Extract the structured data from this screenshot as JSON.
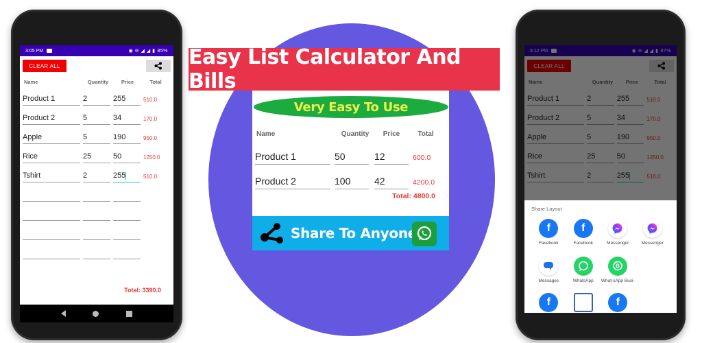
{
  "promo": {
    "title": "Easy List Calculator And Bills",
    "tagline": "Very Easy To Use",
    "share_text": "Share To Anyone",
    "colors": {
      "circle": "#6457e0",
      "banner": "#e8334a",
      "pill": "#1cab3e",
      "share_bar": "#10aee8"
    },
    "headers": {
      "name": "Name",
      "quantity": "Quantity",
      "price": "Price",
      "total": "Total"
    },
    "rows": [
      {
        "name": "Product 1",
        "quantity": "50",
        "price": "12",
        "total": "600.0"
      },
      {
        "name": "Product 2",
        "quantity": "100",
        "price": "42",
        "total": "4200.0"
      }
    ],
    "grand_total": "Total: 4800.0"
  },
  "left_phone": {
    "status": {
      "time": "3:05 PM",
      "battery": "85%"
    },
    "clear_label": "CLEAR ALL",
    "headers": {
      "name": "Name",
      "quantity": "Quantity",
      "price": "Price",
      "total": "Total"
    },
    "rows": [
      {
        "name": "Product 1",
        "quantity": "2",
        "price": "255",
        "total": "510.0"
      },
      {
        "name": "Product 2",
        "quantity": "5",
        "price": "34",
        "total": "170.0"
      },
      {
        "name": "Apple",
        "quantity": "5",
        "price": "190",
        "total": "950.0"
      },
      {
        "name": "Rice",
        "quantity": "25",
        "price": "50",
        "total": "1250.0"
      },
      {
        "name": "Tshirt",
        "quantity": "2",
        "price": "255",
        "total": "510.0"
      }
    ],
    "grand_total": "Total: 3390.0"
  },
  "right_phone": {
    "status": {
      "time": "3:12 PM",
      "battery": "87%"
    },
    "clear_label": "CLEAR ALL",
    "headers": {
      "name": "Name",
      "quantity": "Quantity",
      "price": "Price",
      "total": "Total"
    },
    "rows": [
      {
        "name": "Product 1",
        "quantity": "2",
        "price": "255",
        "total": "510.0"
      },
      {
        "name": "Product 2",
        "quantity": "5",
        "price": "34",
        "total": "170.0"
      },
      {
        "name": "Apple",
        "quantity": "5",
        "price": "190",
        "total": "950.0"
      },
      {
        "name": "Rice",
        "quantity": "25",
        "price": "50",
        "total": "1250.0"
      },
      {
        "name": "Tshirt",
        "quantity": "2",
        "price": "255",
        "total": "510.0"
      }
    ],
    "share_sheet": {
      "title": "Share Layout",
      "apps": [
        {
          "label": "Facebook",
          "icon": "facebook-icon"
        },
        {
          "label": "Facebook",
          "icon": "facebook-icon"
        },
        {
          "label": "Messenger",
          "icon": "messenger-icon"
        },
        {
          "label": "Messenger",
          "icon": "messenger-icon"
        },
        {
          "label": "Messages",
          "icon": "messages-icon"
        },
        {
          "label": "WhatsApp",
          "icon": "whatsapp-icon"
        },
        {
          "label": "What-sApp Busi-",
          "icon": "whatsapp-business-icon"
        }
      ]
    }
  }
}
